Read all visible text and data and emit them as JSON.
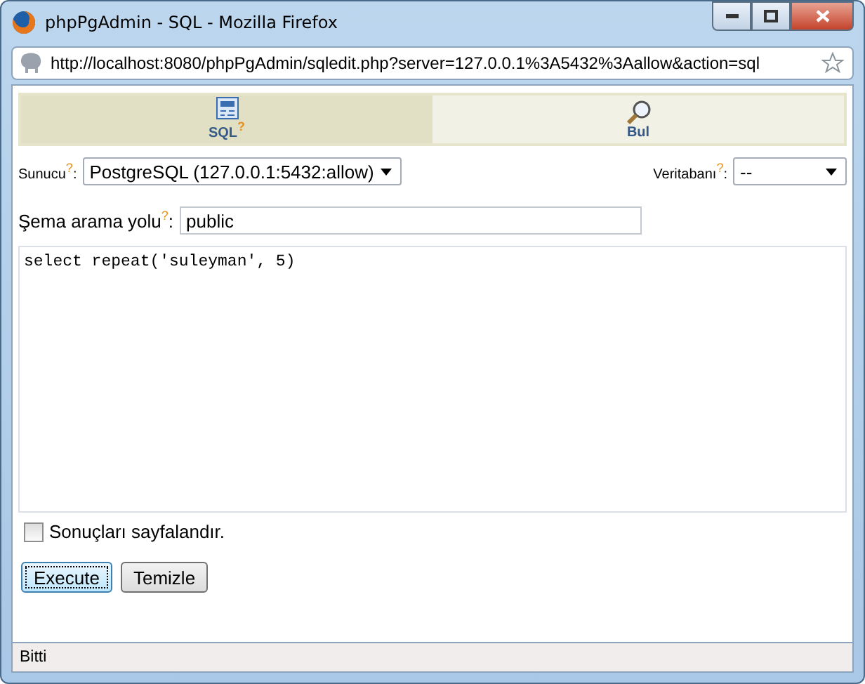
{
  "window": {
    "title": "phpPgAdmin - SQL - Mozilla Firefox"
  },
  "address_bar": {
    "url": "http://localhost:8080/phpPgAdmin/sqledit.php?server=127.0.0.1%3A5432%3Aallow&action=sql"
  },
  "tabs": [
    {
      "label": "SQL$^{?}$",
      "kind": "sql",
      "selected": true
    },
    {
      "label": "Bul",
      "kind": "find",
      "selected": false
    }
  ],
  "server": {
    "label": "Sunucu$^{?}$:",
    "value": "PostgreSQL (127.0.0.1:5432:allow)"
  },
  "database": {
    "label": "Veritabanı$^{?}$:",
    "value": "--"
  },
  "search_path": {
    "label": "Şema arama yolu$^{?}$:",
    "value": "public"
  },
  "query": "select repeat('suleyman', 5)",
  "paginate": {
    "label": "Sonuçları sayfalandır.",
    "checked": false
  },
  "buttons": [
    {
      "label": "Execute",
      "focused": true
    },
    {
      "label": "Temizle",
      "focused": false
    }
  ],
  "status_bar": "Bitti"
}
